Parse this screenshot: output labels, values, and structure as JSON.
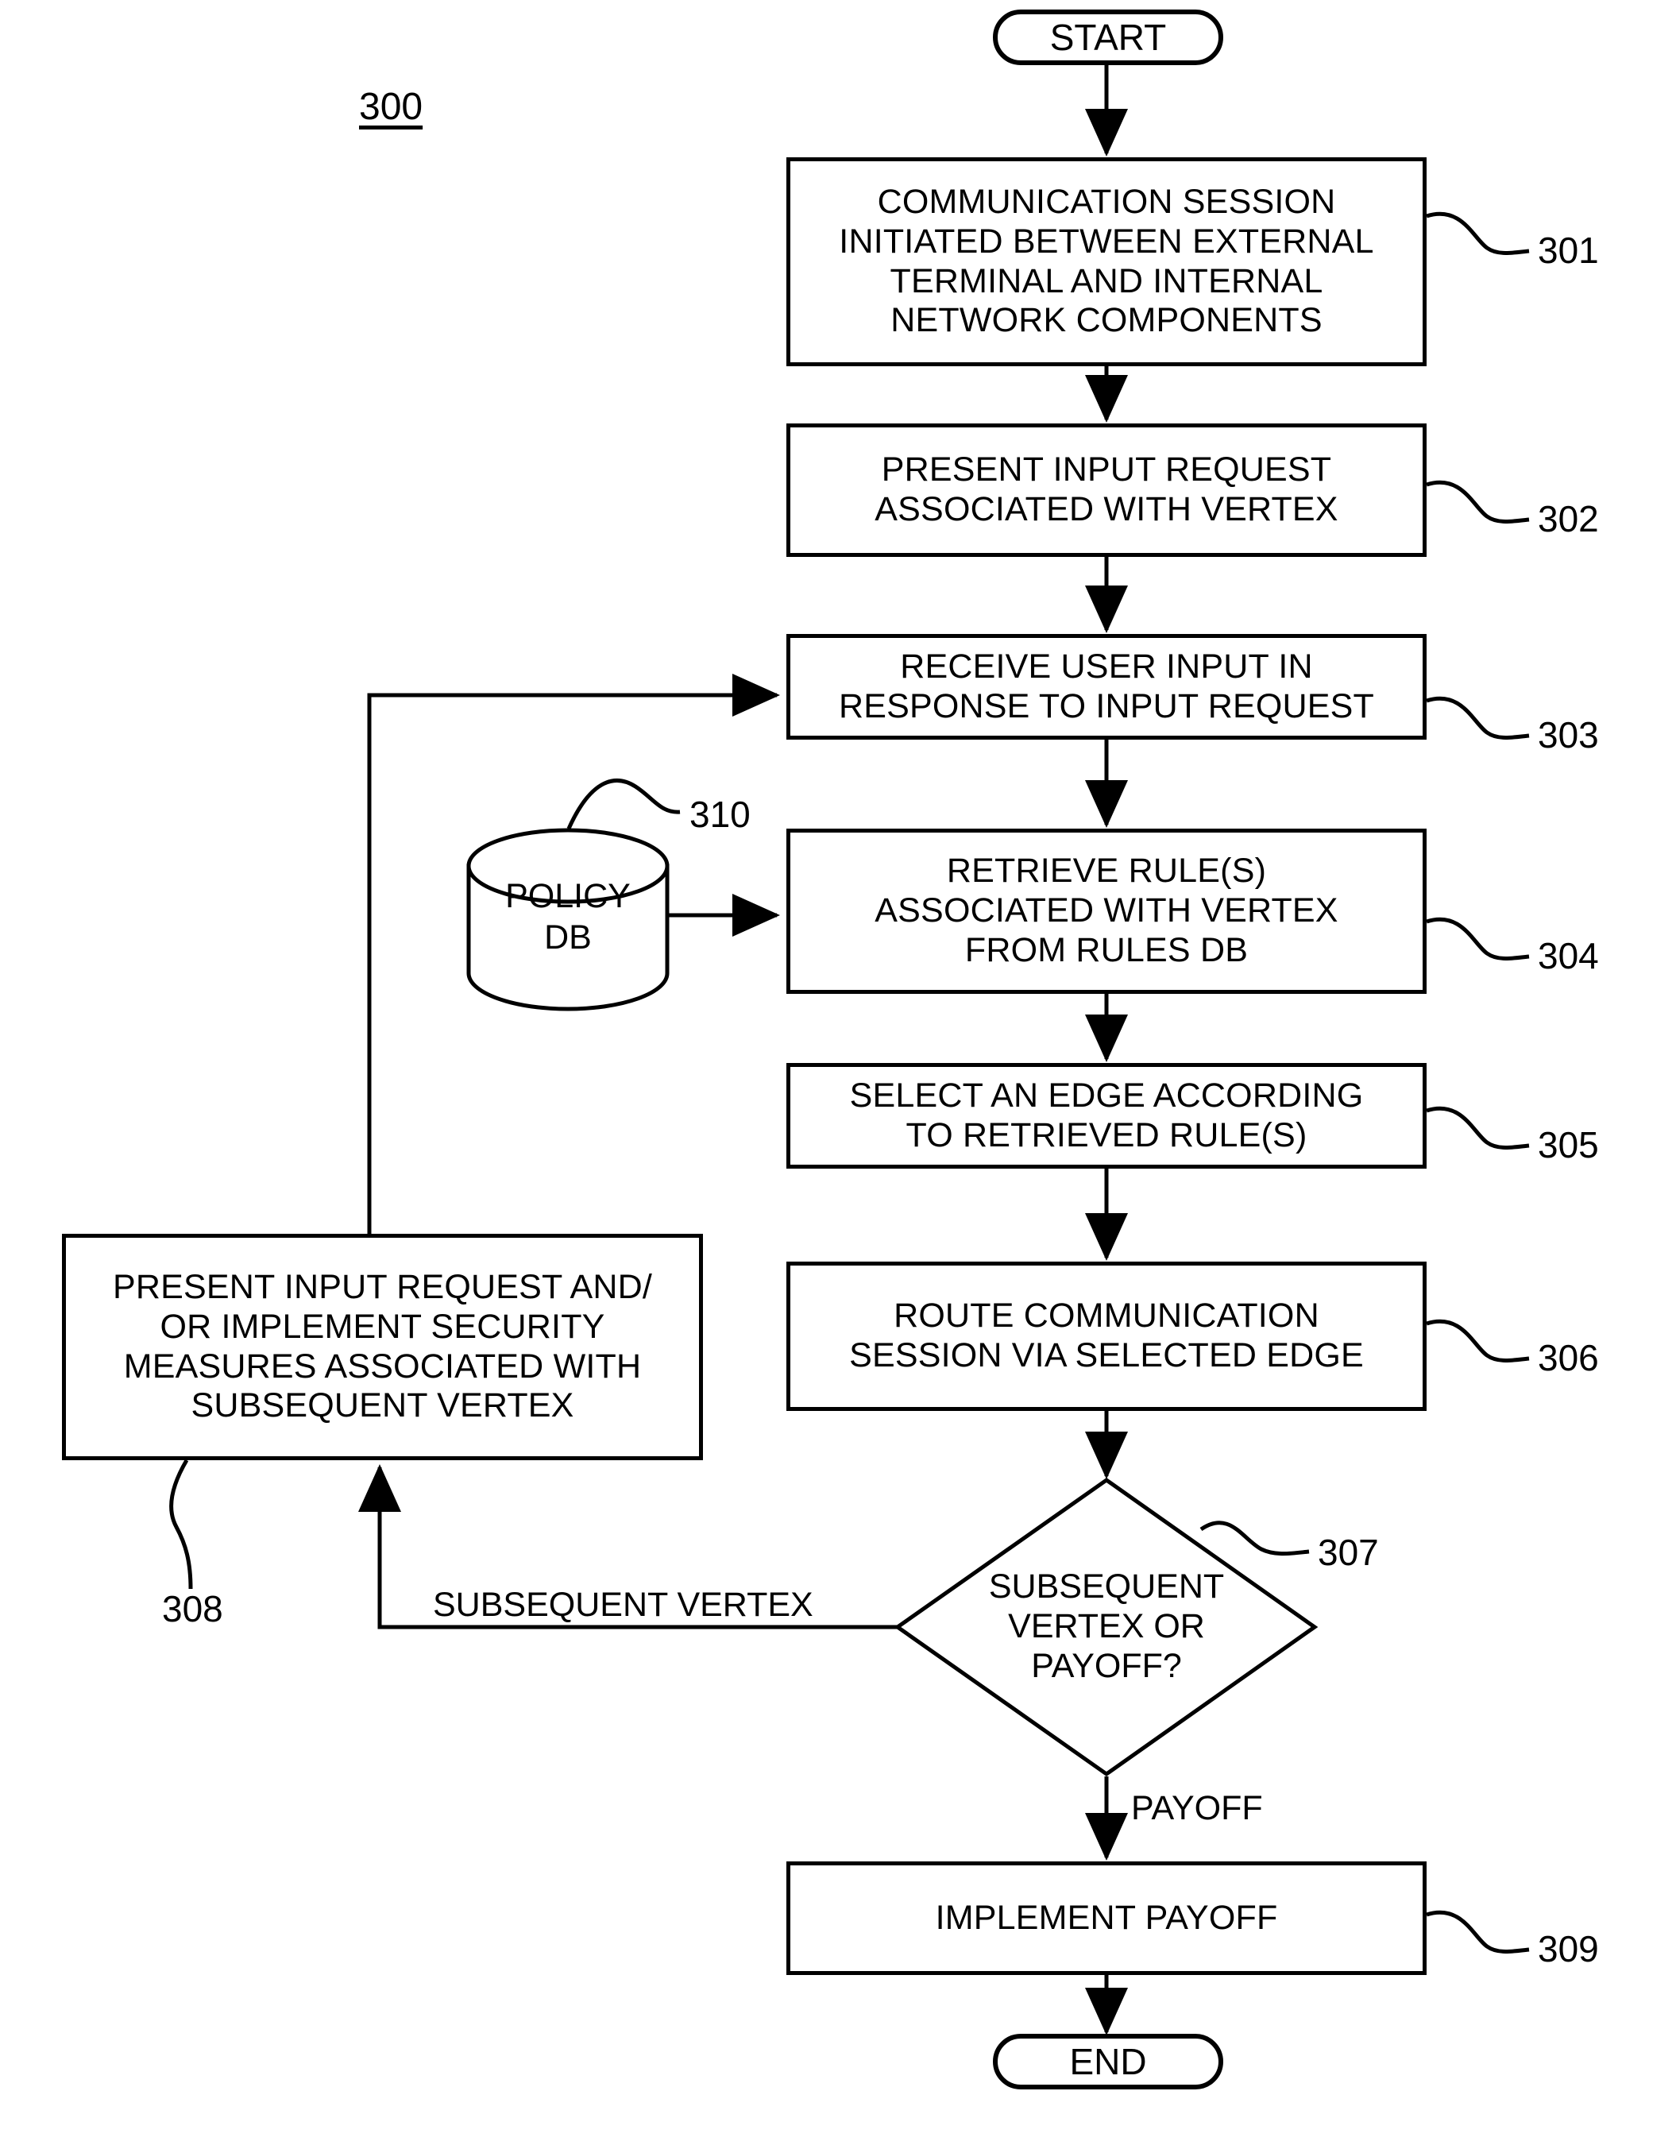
{
  "figure": {
    "number": "300",
    "type": "flowchart"
  },
  "nodes": {
    "start": {
      "label": "START",
      "shape": "terminator"
    },
    "end": {
      "label": "END",
      "shape": "terminator"
    },
    "step301": {
      "ref": "301",
      "shape": "process",
      "lines": [
        "COMMUNICATION SESSION",
        "INITIATED BETWEEN EXTERNAL",
        "TERMINAL AND INTERNAL",
        "NETWORK COMPONENTS"
      ],
      "text": "COMMUNICATION SESSION INITIATED BETWEEN EXTERNAL TERMINAL AND INTERNAL NETWORK COMPONENTS"
    },
    "step302": {
      "ref": "302",
      "shape": "process",
      "lines": [
        "PRESENT INPUT REQUEST",
        "ASSOCIATED WITH VERTEX"
      ],
      "text": "PRESENT INPUT REQUEST ASSOCIATED WITH VERTEX"
    },
    "step303": {
      "ref": "303",
      "shape": "process",
      "lines": [
        "RECEIVE USER INPUT IN",
        "RESPONSE TO INPUT REQUEST"
      ],
      "text": "RECEIVE USER INPUT IN RESPONSE TO INPUT REQUEST"
    },
    "step304": {
      "ref": "304",
      "shape": "process",
      "lines": [
        "RETRIEVE RULE(S)",
        "ASSOCIATED WITH VERTEX",
        "FROM RULES DB"
      ],
      "text": "RETRIEVE RULE(S) ASSOCIATED WITH VERTEX FROM RULES DB"
    },
    "step305": {
      "ref": "305",
      "shape": "process",
      "lines": [
        "SELECT AN EDGE ACCORDING",
        "TO RETRIEVED RULE(S)"
      ],
      "text": "SELECT AN EDGE ACCORDING TO RETRIEVED RULE(S)"
    },
    "step306": {
      "ref": "306",
      "shape": "process",
      "lines": [
        "ROUTE COMMUNICATION",
        "SESSION VIA SELECTED EDGE"
      ],
      "text": "ROUTE COMMUNICATION SESSION VIA SELECTED EDGE"
    },
    "step307": {
      "ref": "307",
      "shape": "decision",
      "lines": [
        "SUBSEQUENT",
        "VERTEX OR",
        "PAYOFF?"
      ],
      "text": "SUBSEQUENT VERTEX OR PAYOFF?"
    },
    "step308": {
      "ref": "308",
      "shape": "process",
      "lines": [
        "PRESENT INPUT REQUEST AND/",
        "OR IMPLEMENT SECURITY",
        "MEASURES ASSOCIATED WITH",
        "SUBSEQUENT VERTEX"
      ],
      "text": "PRESENT INPUT REQUEST AND/OR IMPLEMENT SECURITY MEASURES ASSOCIATED WITH SUBSEQUENT VERTEX"
    },
    "step309": {
      "ref": "309",
      "shape": "process",
      "lines": [
        "IMPLEMENT PAYOFF"
      ],
      "text": "IMPLEMENT PAYOFF"
    },
    "policy_db": {
      "ref": "310",
      "shape": "database-cylinder",
      "lines": [
        "POLICY",
        "DB"
      ],
      "text": "POLICY DB"
    }
  },
  "edge_labels": {
    "subsequent_vertex": "SUBSEQUENT VERTEX",
    "payoff": "PAYOFF"
  },
  "colors": {
    "stroke": "#000000",
    "background": "#ffffff"
  }
}
